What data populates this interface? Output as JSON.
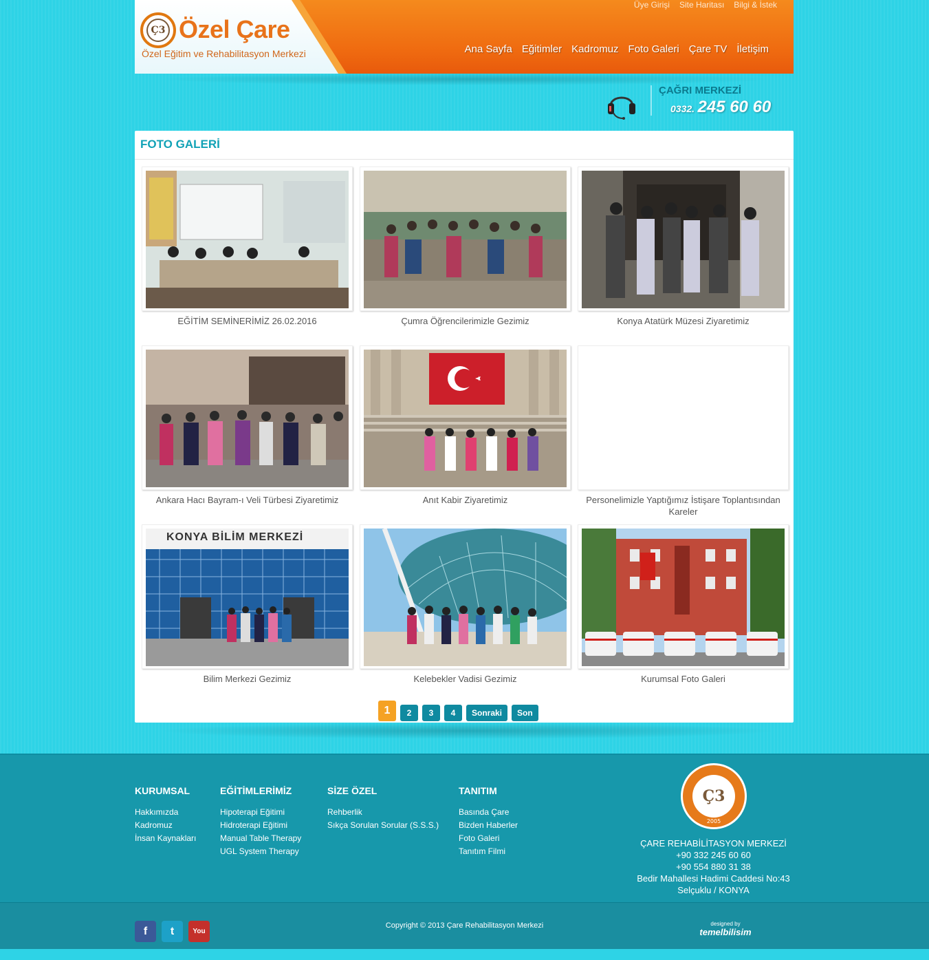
{
  "header": {
    "logo_title": "Özel Çare",
    "logo_subtitle": "Özel Eğitim ve Rehabilitasyon Merkezi",
    "logo_mark": "Ç3",
    "top_links": [
      "Üye Girişi",
      "Site Haritası",
      "Bilgi & İstek"
    ],
    "nav": [
      "Ana Sayfa",
      "Eğitimler",
      "Kadromuz",
      "Foto Galeri",
      "Çare TV",
      "İletişim"
    ]
  },
  "callcenter": {
    "label": "ÇAĞRI MERKEZİ",
    "prefix": "0332.",
    "number": "245 60 60"
  },
  "gallery": {
    "title": "FOTO GALERİ",
    "items": [
      {
        "caption": "EĞİTİM SEMİNERİMİZ 26.02.2016",
        "scene": "classroom"
      },
      {
        "caption": "Çumra Öğrencilerimizle Gezimiz",
        "scene": "group-indoor"
      },
      {
        "caption": "Konya Atatürk Müzesi Ziyaretimiz",
        "scene": "museum"
      },
      {
        "caption": "Ankara Hacı Bayram-ı Veli Türbesi Ziyaretimiz",
        "scene": "mosque"
      },
      {
        "caption": "Anıt Kabir Ziyaretimiz",
        "scene": "anitkabir"
      },
      {
        "caption": "Personelimizle Yaptığımız İstişare Toplantısından Kareler",
        "scene": "empty"
      },
      {
        "caption": "Bilim Merkezi Gezimiz",
        "scene": "science"
      },
      {
        "caption": "Kelebekler Vadisi Gezimiz",
        "scene": "butterfly"
      },
      {
        "caption": "Kurumsal Foto Galeri",
        "scene": "building"
      }
    ],
    "sign_text": "KONYA BİLİM MERKEZİ",
    "pager": [
      "1",
      "2",
      "3",
      "4",
      "Sonraki",
      "Son"
    ]
  },
  "footer": {
    "columns": [
      {
        "title": "KURUMSAL",
        "links": [
          "Hakkımızda",
          "Kadromuz",
          "İnsan Kaynakları"
        ]
      },
      {
        "title": "EĞİTİMLERİMİZ",
        "links": [
          "Hipoterapi Eğitimi",
          "Hidroterapi Eğitimi",
          "Manual Table Therapy",
          "UGL System Therapy"
        ]
      },
      {
        "title": "SİZE ÖZEL",
        "links": [
          "Rehberlik",
          "Sıkça Sorulan Sorular (S.S.S.)"
        ]
      },
      {
        "title": "TANITIM",
        "links": [
          "Basında Çare",
          "Bizden Haberler",
          "Foto Galeri",
          "Tanıtım Filmi"
        ]
      }
    ],
    "logo_year": "2005",
    "address": [
      "ÇARE REHABİLİTASYON MERKEZİ",
      "+90 332 245 60 60",
      "+90 554 880 31 38",
      "Bedir Mahallesi Hadimi Caddesi No:43",
      "Selçuklu / KONYA"
    ],
    "socials": [
      {
        "name": "facebook",
        "glyph": "f",
        "color": "#3b5998"
      },
      {
        "name": "twitter",
        "glyph": "t",
        "color": "#1da1c8"
      },
      {
        "name": "youtube",
        "glyph": "You",
        "color": "#c4302b"
      }
    ],
    "copyright": "Copyright © 2013 Çare Rehabilitasyon Merkezi",
    "designed_by": "designed by",
    "designer": "temelbilisim"
  }
}
